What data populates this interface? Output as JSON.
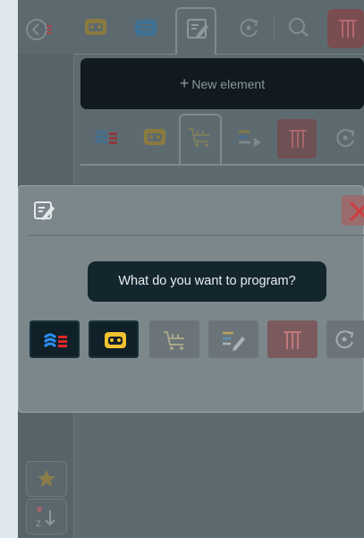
{
  "new_element": {
    "plus": "+",
    "label": "New element"
  },
  "prompt": {
    "question": "What do you want to program?"
  },
  "icons": {
    "back": "back-arrow-icon",
    "tabs": [
      "robot-head-icon",
      "list-icon",
      "edit-icon",
      "refresh-icon",
      "search-icon",
      "gate-icon"
    ],
    "categories": [
      "signals-icon",
      "robot-head-icon",
      "cart-icon",
      "sequence-icon",
      "gate-icon",
      "refresh-icon"
    ],
    "choices": [
      "signals-icon",
      "robot-head-icon",
      "cart-icon",
      "sequence-edit-icon",
      "gate-icon",
      "refresh-icon"
    ],
    "rail": [
      "star-icon",
      "sort-az-icon"
    ]
  },
  "colors": {
    "accent_yellow": "#f2c230",
    "accent_red": "#e02a2a",
    "accent_blue": "#2a8ff2",
    "bubble": "#13262d"
  }
}
